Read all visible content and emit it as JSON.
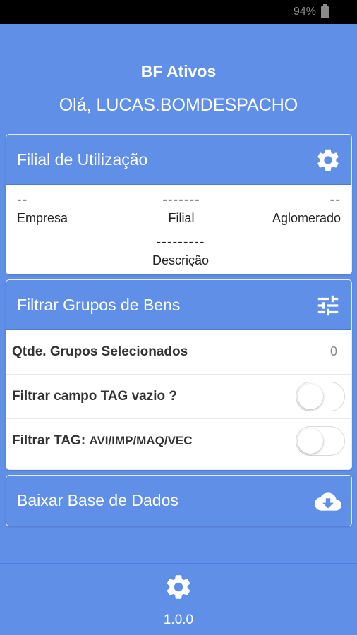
{
  "status_bar": {
    "battery": "94%"
  },
  "header": {
    "app_title": "BF Ativos",
    "greeting": "Olá, LUCAS.BOMDESPACHO"
  },
  "filial_card": {
    "title": "Filial de Utilização",
    "settings_icon": "gear-icon",
    "empresa": {
      "value": "--",
      "label": "Empresa"
    },
    "filial": {
      "value": "-------",
      "label": "Filial"
    },
    "aglomerado": {
      "value": "--",
      "label": "Aglomerado"
    },
    "descricao": {
      "value": "---------",
      "label": "Descrição"
    }
  },
  "grupos_card": {
    "title": "Filtrar Grupos de Bens",
    "filter_icon": "sliders-icon",
    "selected_groups_label": "Qtde. Grupos Selecionados",
    "selected_groups_value": "0",
    "tag_empty_label": "Filtrar campo TAG vazio ?",
    "tag_empty_on": false,
    "tag_filter_label_bold": "Filtrar TAG:",
    "tag_filter_label_values": "AVI/IMP/MAQ/VEC",
    "tag_filter_on": false
  },
  "download_card": {
    "title": "Baixar Base de Dados",
    "icon": "cloud-download-icon"
  },
  "footer": {
    "settings_icon": "gear-icon",
    "version": "1.0.0"
  },
  "colors": {
    "primary": "#5f8fe6",
    "card": "#ffffff",
    "status_bar": "#000000"
  }
}
